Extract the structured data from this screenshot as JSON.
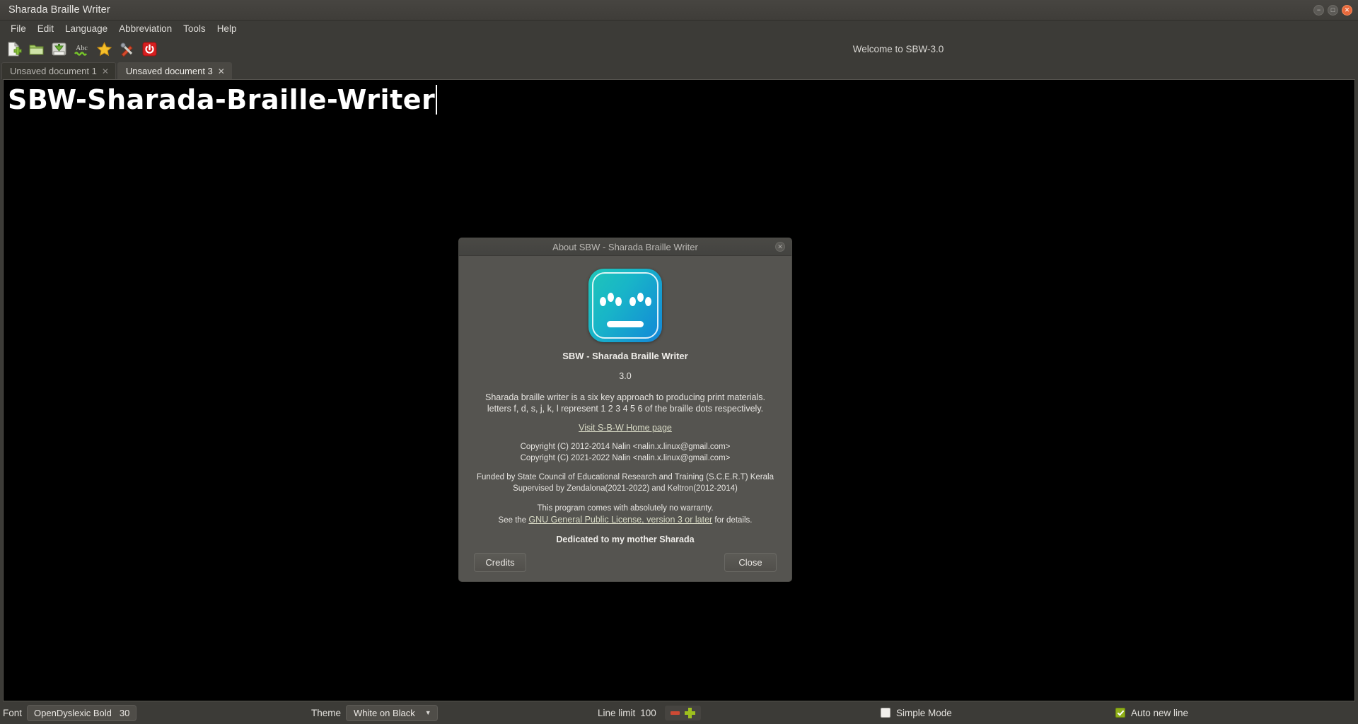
{
  "window": {
    "title": "Sharada Braille Writer",
    "controls": [
      {
        "name": "minimize",
        "glyph": "−"
      },
      {
        "name": "maximize",
        "glyph": "□"
      },
      {
        "name": "close",
        "glyph": "✕"
      }
    ]
  },
  "menubar": {
    "items": [
      "File",
      "Edit",
      "Language",
      "Abbreviation",
      "Tools",
      "Help"
    ]
  },
  "toolbar": {
    "buttons": [
      {
        "name": "new-document-icon",
        "title": "New"
      },
      {
        "name": "open-folder-icon",
        "title": "Open"
      },
      {
        "name": "save-icon",
        "title": "Save"
      },
      {
        "name": "spellcheck-icon",
        "title": "Spell check"
      },
      {
        "name": "favorite-star-icon",
        "title": "Favourite"
      },
      {
        "name": "tools-icon",
        "title": "Tools"
      },
      {
        "name": "power-icon",
        "title": "Quit"
      }
    ],
    "welcome": "Welcome to SBW-3.0"
  },
  "tabs": [
    {
      "label": "Unsaved document 1",
      "close": "✕",
      "active": false
    },
    {
      "label": "Unsaved document 3",
      "close": "✕",
      "active": true
    }
  ],
  "editor": {
    "text": "SBW-Sharada-Braille-Writer"
  },
  "statusbar": {
    "font_label": "Font",
    "font_name": "OpenDyslexic Bold",
    "font_size": "30",
    "theme_label": "Theme",
    "theme_value": "White on Black",
    "theme_arrow": "▼",
    "line_limit_label": "Line limit",
    "line_limit_value": "100",
    "simple_mode_label": "Simple Mode",
    "simple_mode_checked": false,
    "auto_new_line_label": "Auto new line",
    "auto_new_line_checked": true
  },
  "dialog": {
    "title": "About SBW - Sharada Braille Writer",
    "close_glyph": "✕",
    "logo_name": "sbw-braille-logo",
    "app_name": "SBW - Sharada Braille Writer",
    "version": "3.0",
    "description_line1": "Sharada braille writer is a six key approach to producing print materials.",
    "description_line2": "letters f, d, s, j, k, l represent 1 2 3 4 5 6 of the braille dots respectively.",
    "home_link": "Visit S-B-W Home page",
    "copyright_line1": "Copyright (C) 2012-2014 Nalin <nalin.x.linux@gmail.com>",
    "copyright_line2": "Copyright (C) 2021-2022 Nalin <nalin.x.linux@gmail.com>",
    "funding_line1": "Funded by State Council of Educational Research and Training (S.C.E.R.T) Kerala",
    "funding_line2": "Supervised by Zendalona(2021-2022) and Keltron(2012-2014)",
    "warranty_line1": "This program comes with absolutely no warranty.",
    "warranty_prefix": "See the ",
    "license_link": "GNU General Public License, version 3 or later",
    "warranty_suffix": " for details.",
    "dedication": "Dedicated to my mother Sharada",
    "credits_button": "Credits",
    "close_button": "Close"
  },
  "colors": {
    "chrome": "#3c3b37",
    "editor_bg": "#000000",
    "accent_logo_start": "#1fc6b8",
    "accent_logo_end": "#1386d8",
    "close_button": "#e8693c",
    "check_green": "#8fae18"
  }
}
